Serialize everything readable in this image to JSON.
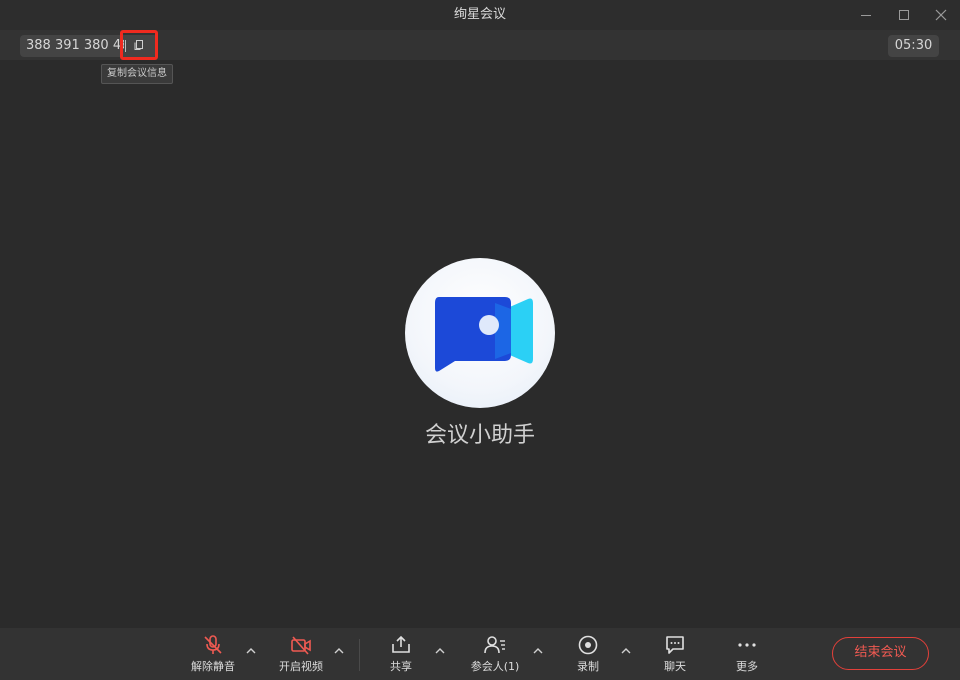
{
  "window": {
    "title": "绚星会议"
  },
  "infobar": {
    "meeting_id": "388 391 380 46",
    "copy_tooltip": "复制会议信息",
    "timer": "05:30"
  },
  "participant": {
    "name": "会议小助手"
  },
  "toolbar": {
    "unmute_label": "解除静音",
    "start_video_label": "开启视频",
    "share_label": "共享",
    "participants_label": "参会人(1)",
    "record_label": "录制",
    "chat_label": "聊天",
    "more_label": "更多",
    "end_meeting_label": "结束会议"
  },
  "colors": {
    "accent_red": "#f05a52",
    "highlight_red": "#f02a1f",
    "background": "#2b2b2b",
    "toolbar": "#333333"
  },
  "icons": {
    "copy": "copy-icon",
    "mic_muted": "mic-off-icon",
    "camera_off": "camera-off-icon",
    "share": "share-icon",
    "participants": "participants-icon",
    "record": "record-icon",
    "chat": "chat-icon",
    "more": "more-icon",
    "caret": "chevron-up-icon"
  }
}
